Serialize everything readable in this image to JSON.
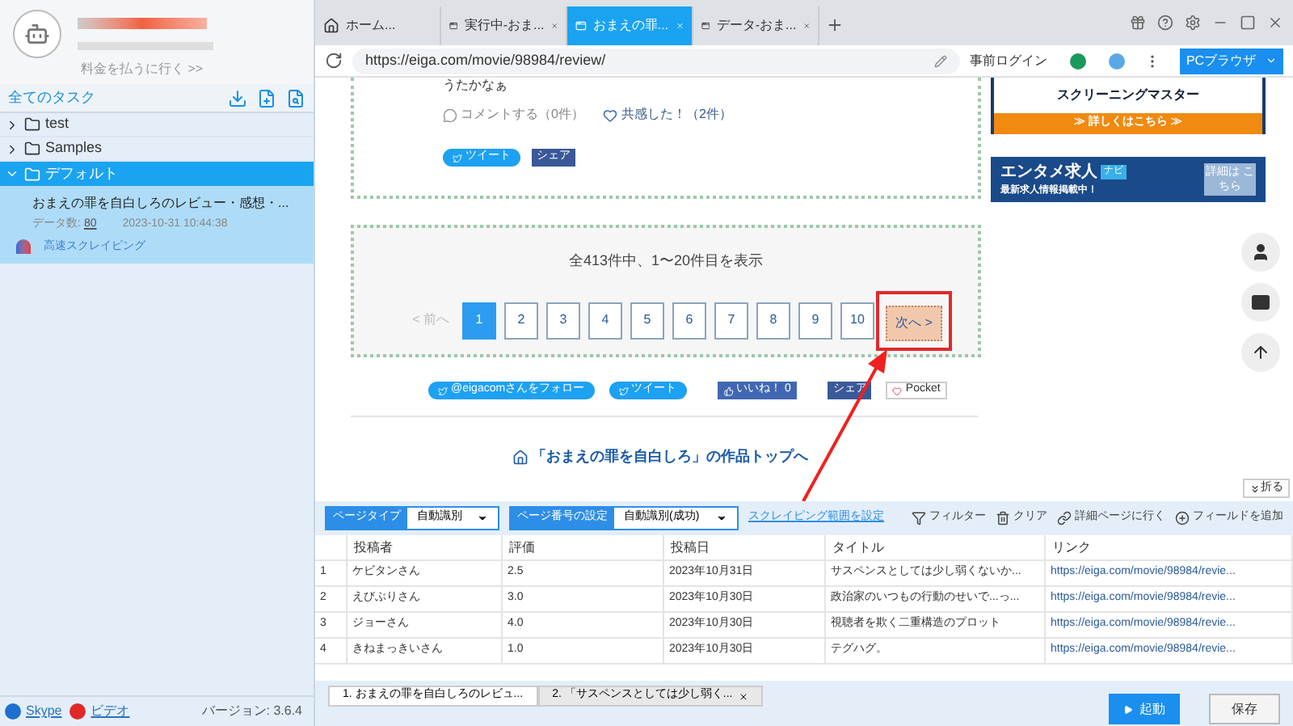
{
  "sidebar": {
    "pay_link": "料金を払うに行く >>",
    "header": "全てのタスク",
    "tree": [
      {
        "label": "test",
        "expanded": false,
        "selected": false
      },
      {
        "label": "Samples",
        "expanded": false,
        "selected": false
      },
      {
        "label": "デフォルト",
        "expanded": true,
        "selected": true
      }
    ],
    "task": {
      "title": "おまえの罪を自白しろのレビュー・感想・...",
      "data_label": "データ数:",
      "data_count": "80",
      "time": "2023-10-31 10:44:38",
      "mode": "高速スクレイピング"
    },
    "footer": {
      "links": [
        {
          "kind": "skype",
          "label": "Skype"
        },
        {
          "kind": "video",
          "label": "ビデオ"
        }
      ],
      "version": "バージョン: 3.6.4"
    }
  },
  "browser_tabs": [
    {
      "kind": "home",
      "label": "ホーム...",
      "selected": false
    },
    {
      "kind": "page",
      "label": "実行中-おま...",
      "selected": false
    },
    {
      "kind": "page",
      "label": "おまえの罪...",
      "selected": true
    },
    {
      "kind": "page",
      "label": "データ-おま...",
      "selected": false
    }
  ],
  "address": "https://eiga.com/movie/98984/review/",
  "login": "事前ログイン",
  "browser_button": "PCブラウザ",
  "page": {
    "review_tail": "うたかなぁ",
    "comment": "コメントする（0件）",
    "empathy": "共感した！（2件）",
    "tweet": "ツイート",
    "share": "シェア",
    "summary": "全413件中、1〜20件目を表示",
    "prev": "< 前へ",
    "pages": [
      {
        "label": "1",
        "selected": true
      },
      {
        "label": "2",
        "selected": false
      },
      {
        "label": "3",
        "selected": false
      },
      {
        "label": "4",
        "selected": false
      },
      {
        "label": "5",
        "selected": false
      },
      {
        "label": "6",
        "selected": false
      },
      {
        "label": "7",
        "selected": false
      },
      {
        "label": "8",
        "selected": false
      },
      {
        "label": "9",
        "selected": false
      },
      {
        "label": "10",
        "selected": false
      }
    ],
    "next": "次へ >",
    "social": [
      {
        "kind": "twitter",
        "label": "@eigacomさんをフォロー"
      },
      {
        "kind": "twitter",
        "label": "ツイート"
      },
      {
        "kind": "like",
        "label": "いいね！ 0"
      },
      {
        "kind": "share",
        "label": "シェア"
      },
      {
        "kind": "pocket",
        "label": "Pocket"
      }
    ],
    "top_link": "「おまえの罪を自白しろ」の作品トップへ",
    "ad1": {
      "title": "スクリーニングマスター",
      "cta": "≫ 詳しくはこちら ≫"
    },
    "ad2": {
      "title": "エンタメ求人",
      "badge": "ナビ",
      "sub": "最新求人情報掲載中！",
      "cta": "詳細は こちら"
    }
  },
  "fold": "折る",
  "panel": {
    "page_type": {
      "label": "ページタイプ",
      "value": "自動識別"
    },
    "page_number": {
      "label": "ページ番号の設定",
      "value": "自動識別(成功)"
    },
    "range_link": "スクレイピング範囲を設定",
    "actions": [
      {
        "kind": "filter",
        "label": "フィルター"
      },
      {
        "kind": "clear",
        "label": "クリア"
      },
      {
        "kind": "link",
        "label": "詳細ページに行く"
      },
      {
        "kind": "add",
        "label": "フィールドを追加"
      }
    ],
    "columns": [
      "",
      "投稿者",
      "評価",
      "投稿日",
      "タイトル",
      "リンク"
    ],
    "rows": [
      [
        "1",
        "ケビタンさん",
        "2.5",
        "2023年10月31日",
        "サスペンスとしては少し弱くないか...",
        "https://eiga.com/movie/98984/revie..."
      ],
      [
        "2",
        "えびぶりさん",
        "3.0",
        "2023年10月30日",
        "政治家のいつもの行動のせいで...っ...",
        "https://eiga.com/movie/98984/revie..."
      ],
      [
        "3",
        "ジョーさん",
        "4.0",
        "2023年10月30日",
        "視聴者を欺く二重構造のプロット",
        "https://eiga.com/movie/98984/revie..."
      ],
      [
        "4",
        "きねまっきいさん",
        "1.0",
        "2023年10月30日",
        "テグハグ。",
        "https://eiga.com/movie/98984/revie..."
      ]
    ],
    "task_tabs": [
      {
        "label": "1. おまえの罪を自白しろのレビュ...",
        "selected": true,
        "closable": false
      },
      {
        "label": "2. 「サスペンスとしては少し弱く...",
        "selected": false,
        "closable": true
      }
    ],
    "start": "起動",
    "save": "保存"
  }
}
